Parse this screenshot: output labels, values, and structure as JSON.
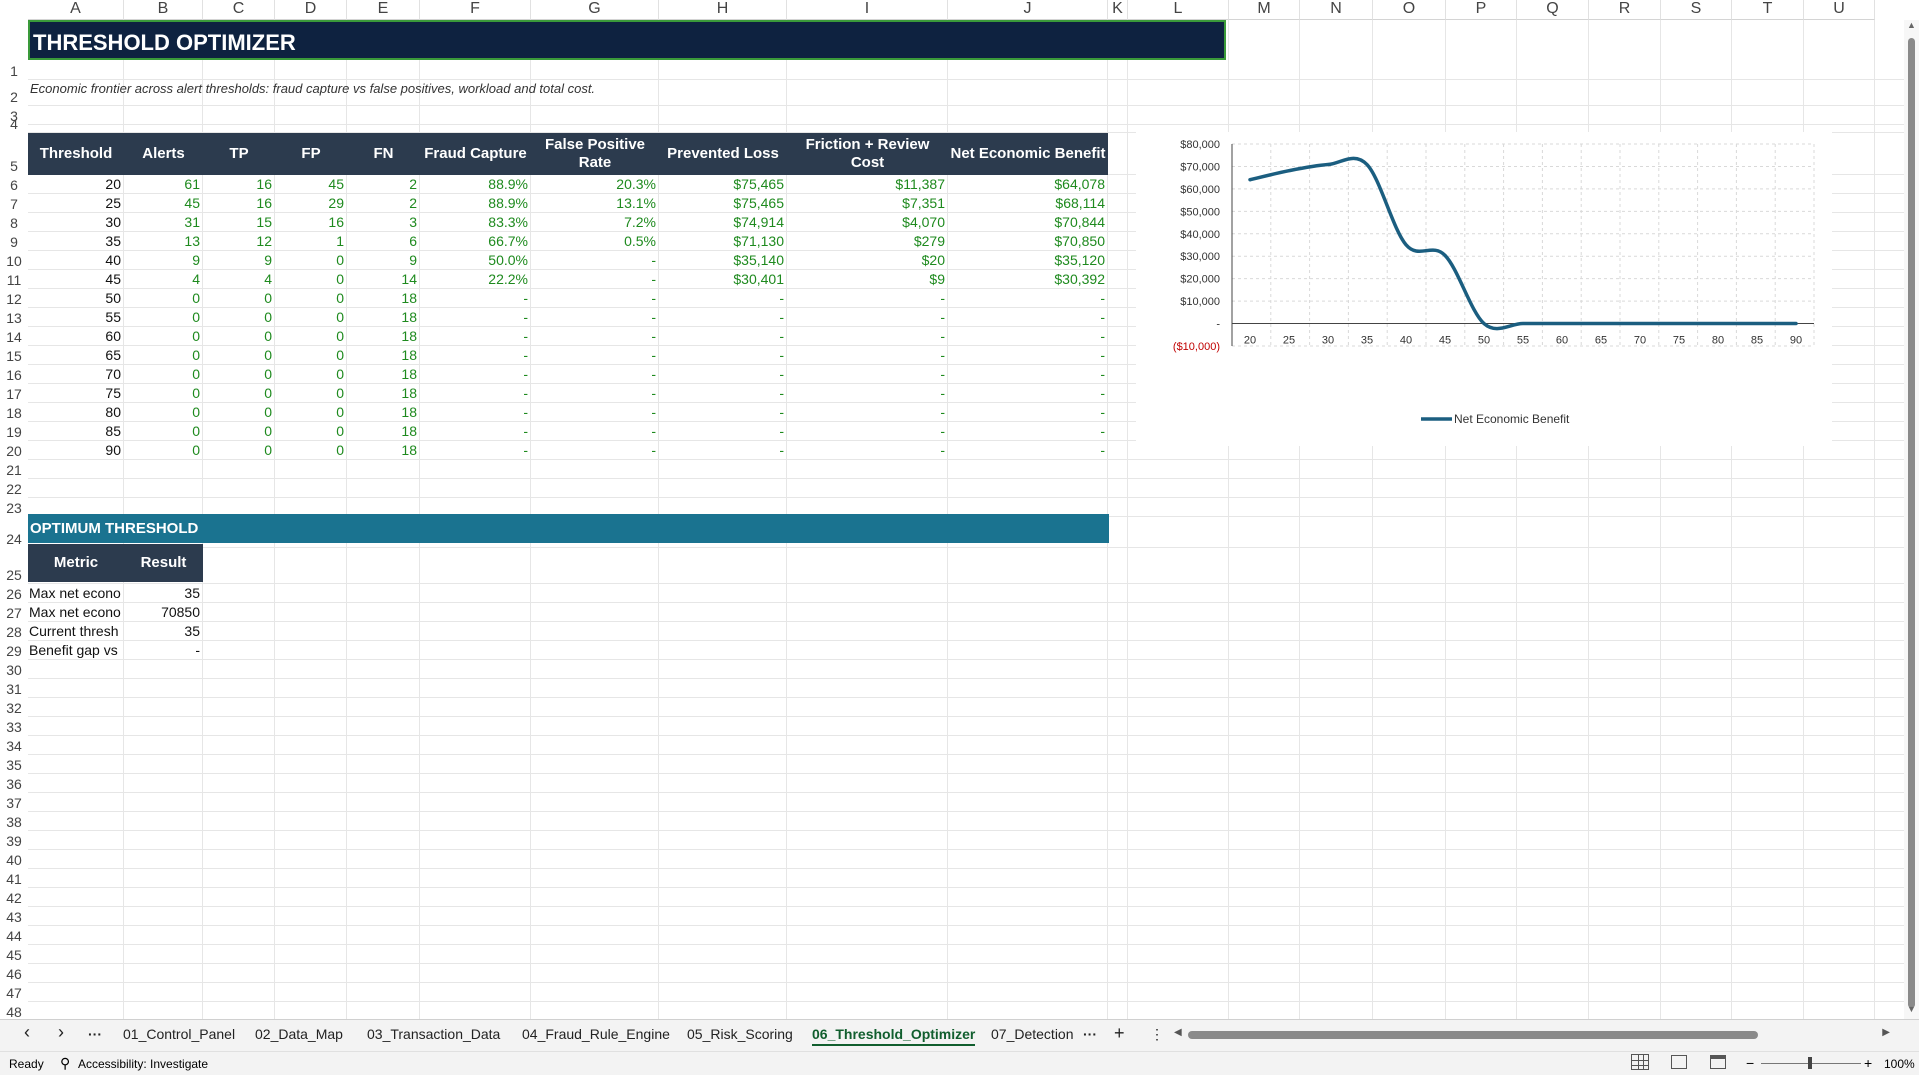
{
  "columns": [
    "A",
    "B",
    "C",
    "D",
    "E",
    "F",
    "G",
    "H",
    "I",
    "J",
    "K",
    "L",
    "M",
    "N",
    "O",
    "P",
    "Q",
    "R",
    "S",
    "T",
    "U"
  ],
  "rows": [
    "1",
    "2",
    "3",
    "4",
    "5",
    "6",
    "7",
    "8",
    "9",
    "10",
    "11",
    "12",
    "13",
    "14",
    "15",
    "16",
    "17",
    "18",
    "19",
    "20",
    "21",
    "22",
    "23",
    "24",
    "25",
    "26",
    "27",
    "28",
    "29",
    "30",
    "31",
    "32",
    "33",
    "34",
    "35",
    "36",
    "37",
    "38",
    "39",
    "40",
    "41",
    "42",
    "43",
    "44",
    "45",
    "46",
    "47",
    "48"
  ],
  "sheet": {
    "title": "THRESHOLD OPTIMIZER",
    "subtitle": "Economic frontier across alert thresholds: fraud capture vs false positives, workload and total cost.",
    "table_headers": [
      "Threshold",
      "Alerts",
      "TP",
      "FP",
      "FN",
      "Fraud Capture",
      "False Positive Rate",
      "Prevented Loss",
      "Friction + Review Cost",
      "Net Economic Benefit"
    ],
    "table_rows": [
      [
        "20",
        "61",
        "16",
        "45",
        "2",
        "88.9%",
        "20.3%",
        "$75,465",
        "$11,387",
        "$64,078"
      ],
      [
        "25",
        "45",
        "16",
        "29",
        "2",
        "88.9%",
        "13.1%",
        "$75,465",
        "$7,351",
        "$68,114"
      ],
      [
        "30",
        "31",
        "15",
        "16",
        "3",
        "83.3%",
        "7.2%",
        "$74,914",
        "$4,070",
        "$70,844"
      ],
      [
        "35",
        "13",
        "12",
        "1",
        "6",
        "66.7%",
        "0.5%",
        "$71,130",
        "$279",
        "$70,850"
      ],
      [
        "40",
        "9",
        "9",
        "0",
        "9",
        "50.0%",
        "-",
        "$35,140",
        "$20",
        "$35,120"
      ],
      [
        "45",
        "4",
        "4",
        "0",
        "14",
        "22.2%",
        "-",
        "$30,401",
        "$9",
        "$30,392"
      ],
      [
        "50",
        "0",
        "0",
        "0",
        "18",
        "-",
        "-",
        "-",
        "-",
        "-"
      ],
      [
        "55",
        "0",
        "0",
        "0",
        "18",
        "-",
        "-",
        "-",
        "-",
        "-"
      ],
      [
        "60",
        "0",
        "0",
        "0",
        "18",
        "-",
        "-",
        "-",
        "-",
        "-"
      ],
      [
        "65",
        "0",
        "0",
        "0",
        "18",
        "-",
        "-",
        "-",
        "-",
        "-"
      ],
      [
        "70",
        "0",
        "0",
        "0",
        "18",
        "-",
        "-",
        "-",
        "-",
        "-"
      ],
      [
        "75",
        "0",
        "0",
        "0",
        "18",
        "-",
        "-",
        "-",
        "-",
        "-"
      ],
      [
        "80",
        "0",
        "0",
        "0",
        "18",
        "-",
        "-",
        "-",
        "-",
        "-"
      ],
      [
        "85",
        "0",
        "0",
        "0",
        "18",
        "-",
        "-",
        "-",
        "-",
        "-"
      ],
      [
        "90",
        "0",
        "0",
        "0",
        "18",
        "-",
        "-",
        "-",
        "-",
        "-"
      ]
    ],
    "optimum_title": "OPTIMUM THRESHOLD",
    "optimum_headers": [
      "Metric",
      "Result"
    ],
    "optimum_rows": [
      [
        "Max net econo",
        "35"
      ],
      [
        "Max net econo",
        "70850"
      ],
      [
        "Current thresh",
        "35"
      ],
      [
        "Benefit gap vs",
        "-"
      ]
    ]
  },
  "chart_data": {
    "type": "line",
    "x": [
      "20",
      "25",
      "30",
      "35",
      "40",
      "45",
      "50",
      "55",
      "60",
      "65",
      "70",
      "75",
      "80",
      "85",
      "90"
    ],
    "series": [
      {
        "name": "Net Economic Benefit",
        "values": [
          64078,
          68114,
          70844,
          70850,
          35120,
          30392,
          0,
          0,
          0,
          0,
          0,
          0,
          0,
          0,
          0
        ],
        "color": "#1b5e80"
      }
    ],
    "ylim": [
      -10000,
      80000
    ],
    "yticks": [
      "$80,000",
      "$70,000",
      "$60,000",
      "$50,000",
      "$40,000",
      "$30,000",
      "$20,000",
      "$10,000",
      "-",
      "($10,000)"
    ],
    "grid": true,
    "legend": "bottom"
  },
  "tabs": {
    "items": [
      "01_Control_Panel",
      "02_Data_Map",
      "03_Transaction_Data",
      "04_Fraud_Rule_Engine",
      "05_Risk_Scoring",
      "06_Threshold_Optimizer",
      "07_Detection"
    ],
    "active": "06_Threshold_Optimizer",
    "prev": "‹",
    "next": "›",
    "more": "···",
    "add": "+",
    "menu": "⋮"
  },
  "status": {
    "ready": "Ready",
    "accessibility": "Accessibility: Investigate",
    "zoom": "100%",
    "zoom_out": "−",
    "zoom_in": "+"
  }
}
